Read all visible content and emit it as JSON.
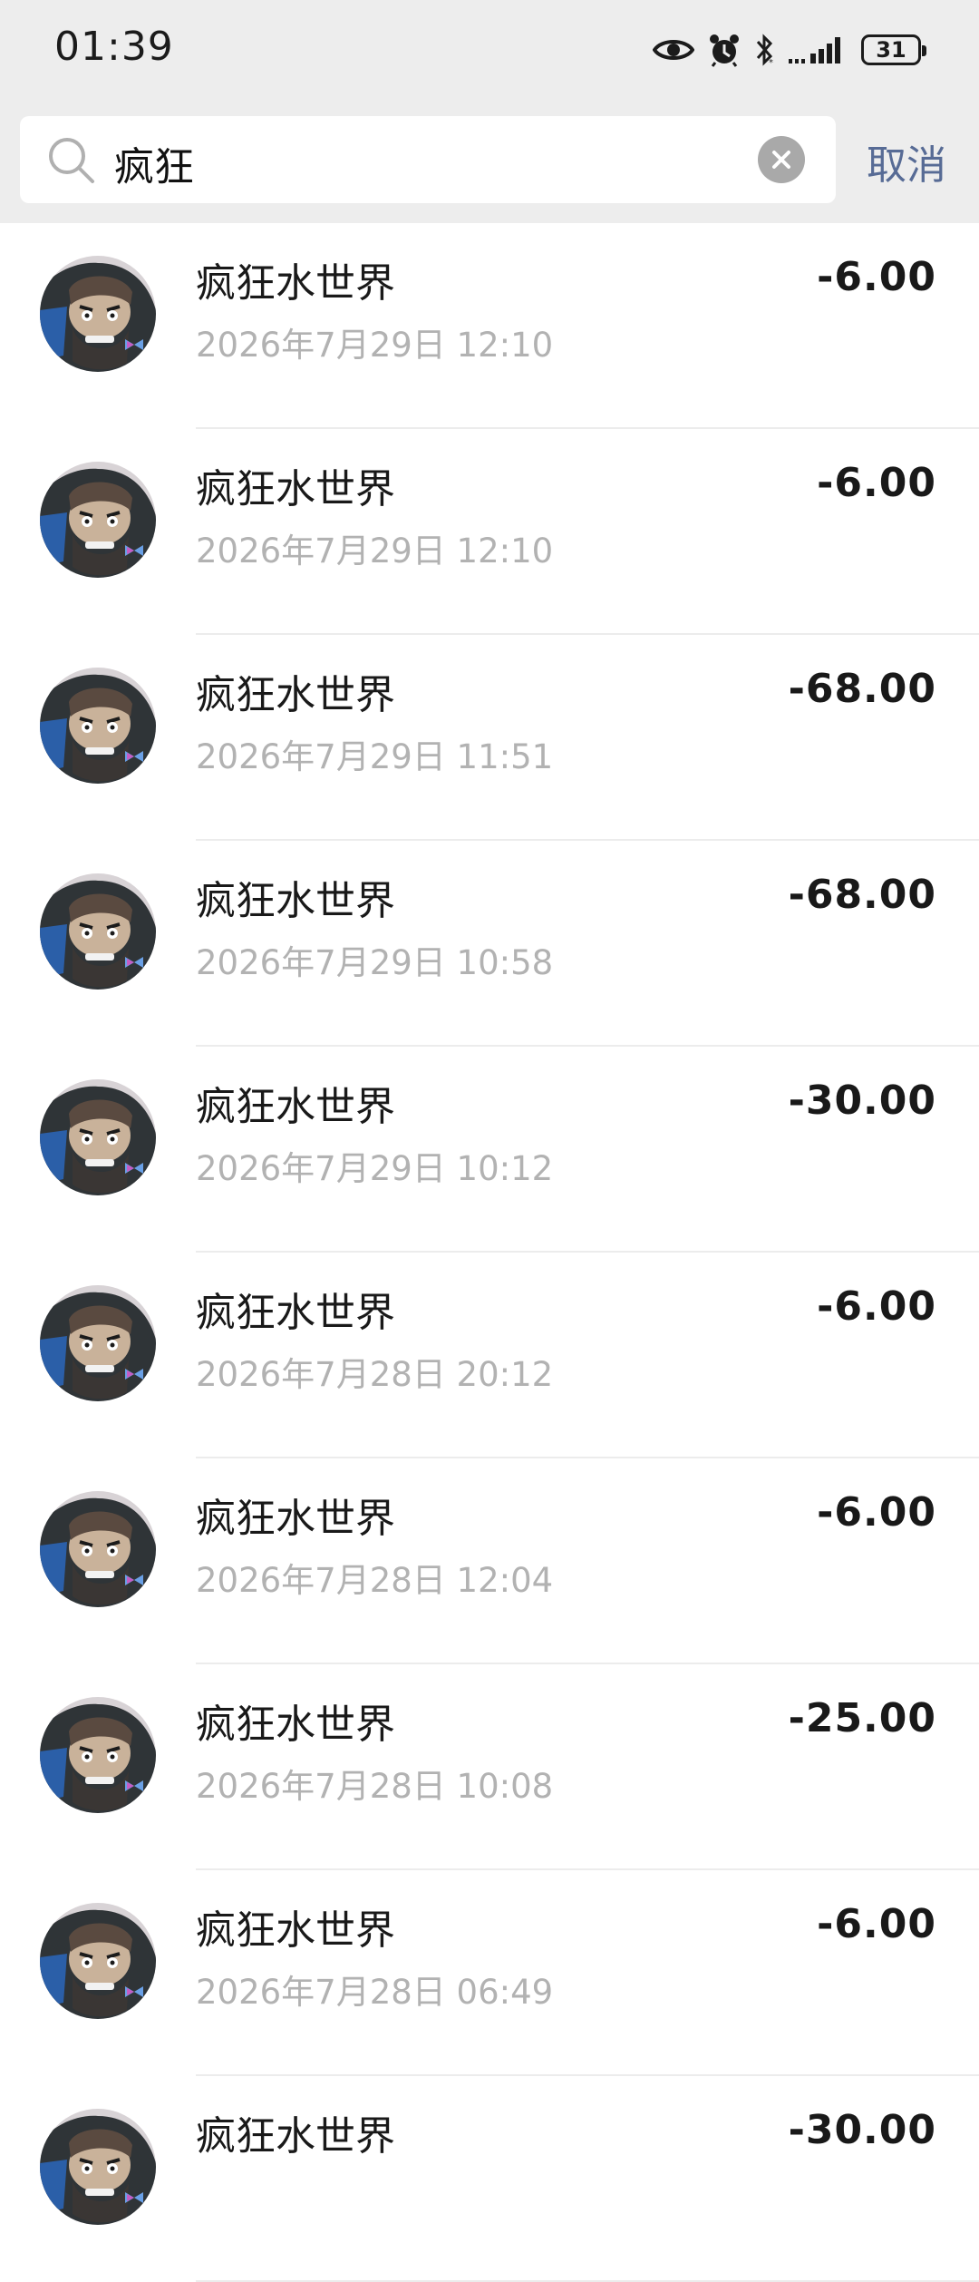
{
  "status_bar": {
    "time": "01:39",
    "battery": "31",
    "icons": [
      "eye-icon",
      "alarm-icon",
      "bluetooth-icon",
      "signal-icon",
      "battery-icon"
    ]
  },
  "search": {
    "query": "疯狂",
    "cancel_label": "取消"
  },
  "colors": {
    "cancel": "#576b95",
    "background_top": "#ededed",
    "date_gray": "#b2b2b2"
  },
  "transactions": [
    {
      "name": "疯狂水世界",
      "date": "2026年7月29日 12:10",
      "amount": "-6.00"
    },
    {
      "name": "疯狂水世界",
      "date": "2026年7月29日 12:10",
      "amount": "-6.00"
    },
    {
      "name": "疯狂水世界",
      "date": "2026年7月29日 11:51",
      "amount": "-68.00"
    },
    {
      "name": "疯狂水世界",
      "date": "2026年7月29日 10:58",
      "amount": "-68.00"
    },
    {
      "name": "疯狂水世界",
      "date": "2026年7月29日 10:12",
      "amount": "-30.00"
    },
    {
      "name": "疯狂水世界",
      "date": "2026年7月28日 20:12",
      "amount": "-6.00"
    },
    {
      "name": "疯狂水世界",
      "date": "2026年7月28日 12:04",
      "amount": "-6.00"
    },
    {
      "name": "疯狂水世界",
      "date": "2026年7月28日 10:08",
      "amount": "-25.00"
    },
    {
      "name": "疯狂水世界",
      "date": "2026年7月28日 06:49",
      "amount": "-6.00"
    },
    {
      "name": "疯狂水世界",
      "date": "",
      "amount": "-30.00"
    }
  ]
}
